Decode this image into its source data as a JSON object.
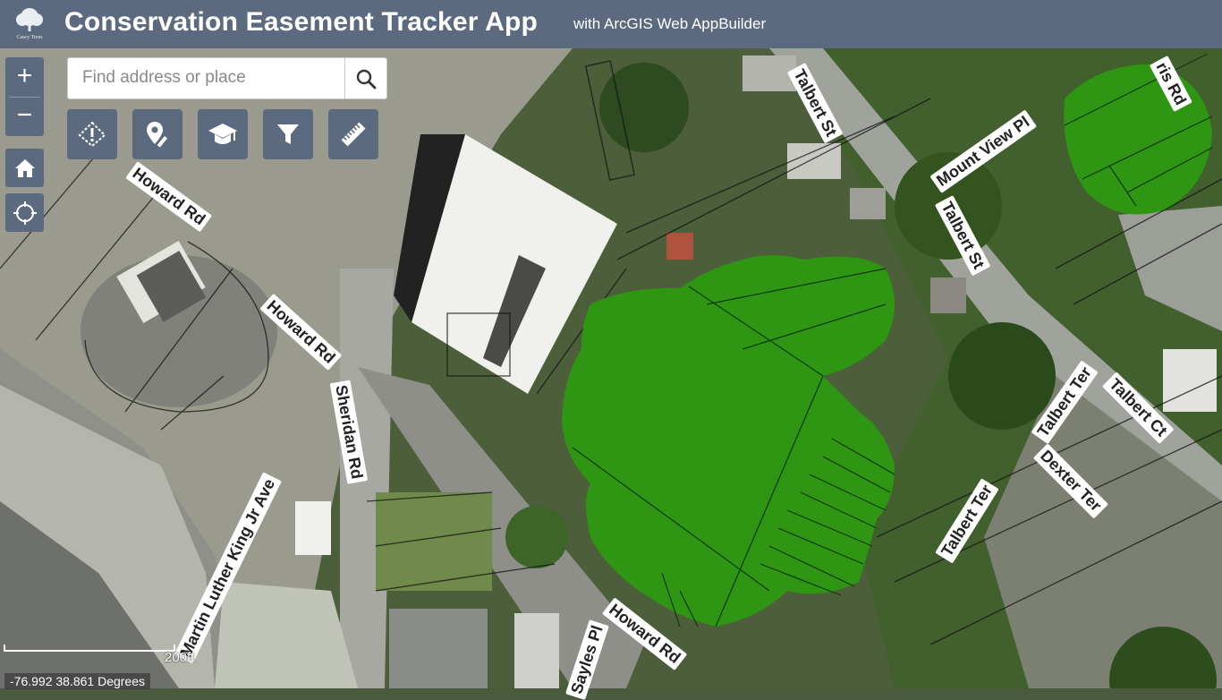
{
  "header": {
    "title": "Conservation Easement Tracker App",
    "subtitle": "with ArcGIS Web AppBuilder",
    "logo_text": "Casey Trees"
  },
  "search": {
    "placeholder": "Find address or place",
    "value": ""
  },
  "zoom": {
    "in_label": "+",
    "out_label": "−"
  },
  "toolbar": [
    "warning-icon",
    "edit-location-icon",
    "education-icon",
    "filter-icon",
    "measure-icon"
  ],
  "map": {
    "scale_label": "200ft",
    "coords_text": "-76.992 38.861 Degrees",
    "road_labels": {
      "howard_rd_1": "Howard Rd",
      "howard_rd_2": "Howard Rd",
      "howard_rd_3": "Howard Rd",
      "sheridan_rd": "Sheridan Rd",
      "mlk_ave": "Martin Luther King Jr Ave",
      "talbert_st_1": "Talbert St",
      "talbert_st_2": "Talbert St",
      "mount_view_pl": "Mount View Pl",
      "talbert_ter_1": "Talbert Ter",
      "talbert_ter_2": "Talbert Ter",
      "talbert_ct": "Talbert Ct",
      "dexter_ter": "Dexter Ter",
      "sayles_pl": "Sayles Pl",
      "morris_rd": "ris Rd"
    }
  },
  "colors": {
    "header": "#5b6a7e",
    "easement": "#2e9612"
  }
}
